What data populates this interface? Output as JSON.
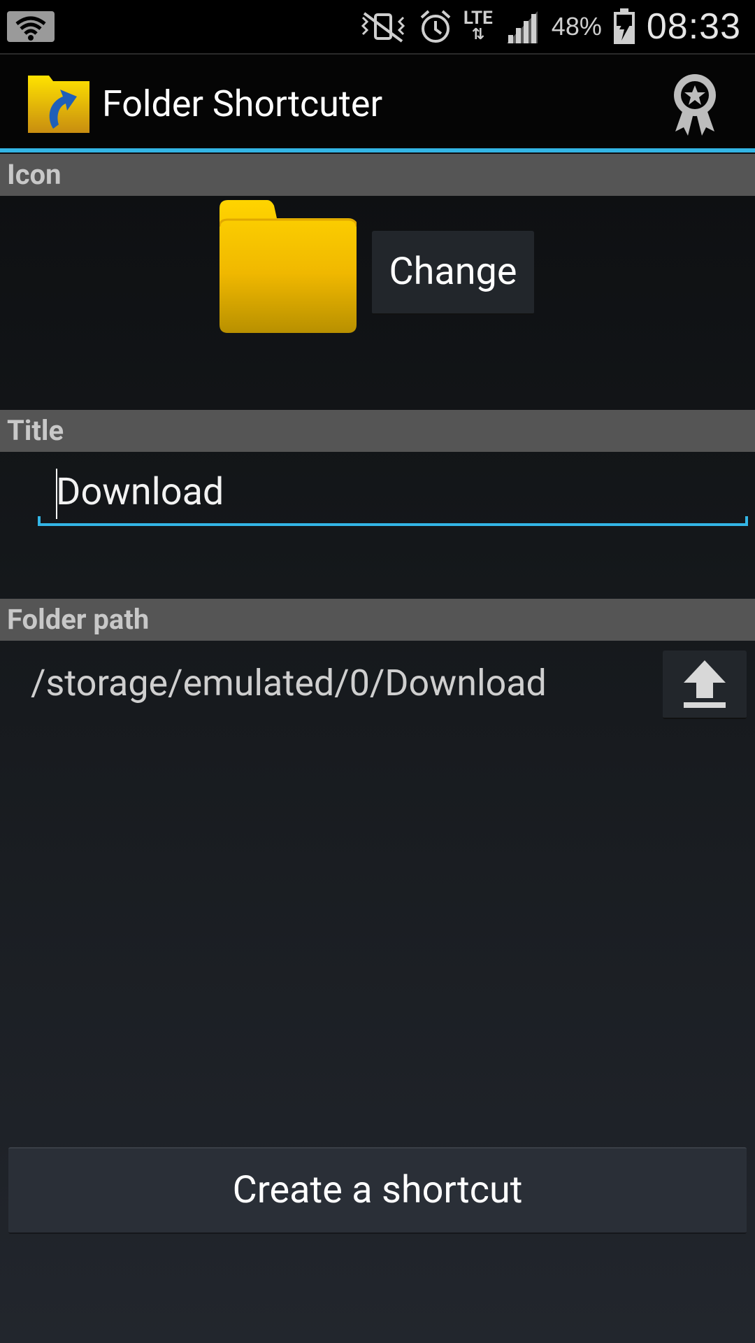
{
  "status_bar": {
    "lte_label": "LTE",
    "battery_percent": "48%",
    "time": "08:33",
    "icons": [
      "wifi-icon",
      "mute-vibrate-icon",
      "alarm-icon",
      "lte-data-icon",
      "signal-icon",
      "battery-charging-icon"
    ]
  },
  "action_bar": {
    "app_title": "Folder Shortcuter",
    "app_icon": "folder-shortcut-app-icon",
    "action_icon": "award-ribbon-icon"
  },
  "sections": {
    "icon_header": "Icon",
    "title_header": "Title",
    "path_header": "Folder path"
  },
  "icon_section": {
    "icon": "yellow-folder-icon",
    "change_label": "Change"
  },
  "title_section": {
    "value": "Download"
  },
  "path_section": {
    "path": "/storage/emulated/0/Download",
    "up_icon": "upload-arrow-icon"
  },
  "footer": {
    "create_label": "Create a shortcut"
  },
  "colors": {
    "accent": "#33b5e5",
    "header_bg": "#555555",
    "folder_yellow": "#ffcc00"
  }
}
